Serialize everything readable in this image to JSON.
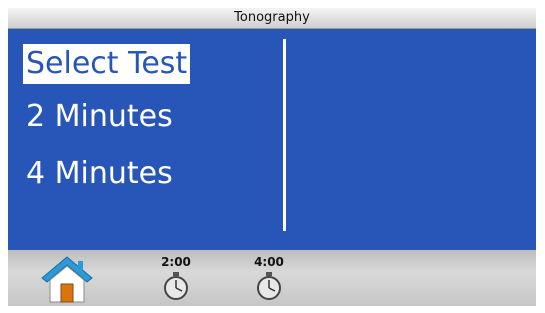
{
  "window": {
    "title": "Tonography"
  },
  "menu": {
    "items": [
      {
        "label": "Select Test",
        "selected": true
      },
      {
        "label": "2 Minutes",
        "selected": false
      },
      {
        "label": "4 Minutes",
        "selected": false
      }
    ]
  },
  "toolbar": {
    "home_icon": "home-icon",
    "timers": [
      {
        "label": "2:00",
        "icon": "stopwatch-icon"
      },
      {
        "label": "4:00",
        "icon": "stopwatch-icon"
      }
    ]
  },
  "colors": {
    "accent_blue": "#2756b8",
    "house_roof": "#2b9ad8",
    "house_body": "#ffffff",
    "house_door": "#d9750f"
  }
}
